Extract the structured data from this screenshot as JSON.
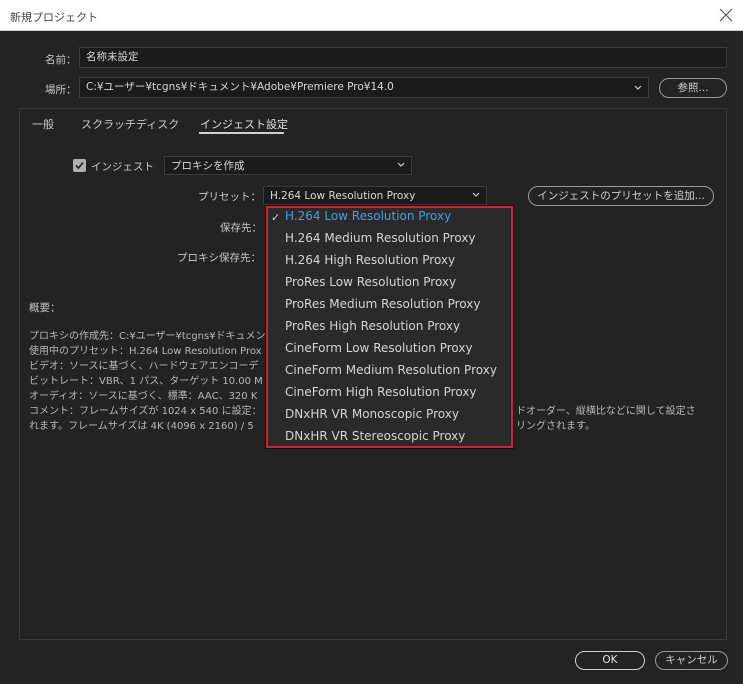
{
  "window": {
    "title": "新規プロジェクト"
  },
  "name_row": {
    "label": "名前：",
    "value": "名称未設定"
  },
  "location_row": {
    "label": "場所：",
    "value": "C:¥ユーザー¥tcgns¥ドキュメント¥Adobe¥Premiere Pro¥14.0",
    "browse_label": "参照..."
  },
  "tabs": [
    {
      "label": "一般"
    },
    {
      "label": "スクラッチディスク"
    },
    {
      "label": "インジェスト設定"
    }
  ],
  "ingest": {
    "checkbox_label": "インジェスト",
    "checked": true,
    "action_value": "プロキシを作成",
    "preset_label": "プリセット：",
    "preset_value": "H.264 Low Resolution Proxy",
    "add_preset_label": "インジェストのプリセットを追加...",
    "destination_label": "保存先：",
    "proxy_destination_label": "プロキシ保存先："
  },
  "summary": {
    "heading": "概要：",
    "lines": [
      "プロキシの作成先：C:¥ユーザー¥tcgns¥ドキュメン",
      "使用中のプリセット：H.264 Low Resolution Prox",
      "ビデオ：ソースに基づく、ハードウェアエンコーデ",
      "ビットレート：VBR、1 パス、ターゲット 10.00 M",
      "オーディオ：ソースに基づく、標準：AAC、320 K",
      "コメント：フレームサイズが 1024 x 540 に設定：",
      "れます。フレームサイズは 4K (4096 x 2160) / 5"
    ],
    "right_fragments": [
      "ドオーダー、縦横比などに関して設定さ",
      "リングされます。"
    ]
  },
  "preset_menu": {
    "selected_index": 0,
    "items": [
      "H.264 Low Resolution Proxy",
      "H.264 Medium Resolution Proxy",
      "H.264 High Resolution Proxy",
      "ProRes Low Resolution Proxy",
      "ProRes Medium Resolution Proxy",
      "ProRes High Resolution Proxy",
      "CineForm Low Resolution Proxy",
      "CineForm Medium Resolution Proxy",
      "CineForm High Resolution Proxy",
      "DNxHR VR Monoscopic Proxy",
      "DNxHR VR Stereoscopic Proxy"
    ]
  },
  "footer": {
    "ok_label": "OK",
    "cancel_label": "キャンセル"
  },
  "colors": {
    "highlight_border": "#d1232a",
    "selected_text": "#3f9fe6",
    "background": "#232323"
  },
  "icons": {
    "close": "close-icon",
    "chevron": "chevron-down-icon",
    "check": "checkmark-icon"
  }
}
